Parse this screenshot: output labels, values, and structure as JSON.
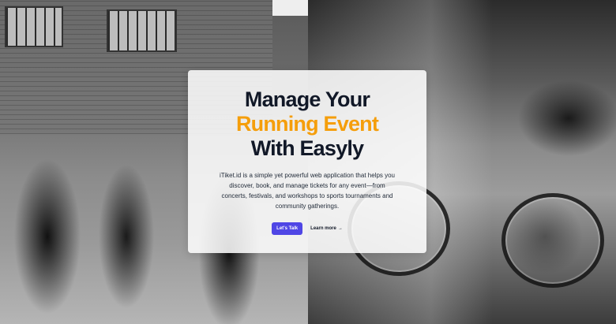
{
  "hero": {
    "title_line1": "Manage Your",
    "title_line2": "Running Event",
    "title_line3": "With Easyly",
    "description": "iTiket.id is a simple yet powerful web application that helps you discover, book, and manage tickets for any event—from concerts, festivals, and workshops to sports tournaments and community gatherings.",
    "primary_button": "Let's Talk",
    "secondary_link": "Learn more",
    "secondary_icon": "→"
  },
  "colors": {
    "heading": "#111827",
    "accent": "#f59e0b",
    "button": "#4f46e5"
  },
  "background": {
    "left_image": "marathon-runners-photo",
    "right_image": "cyclists-racing-photo"
  }
}
